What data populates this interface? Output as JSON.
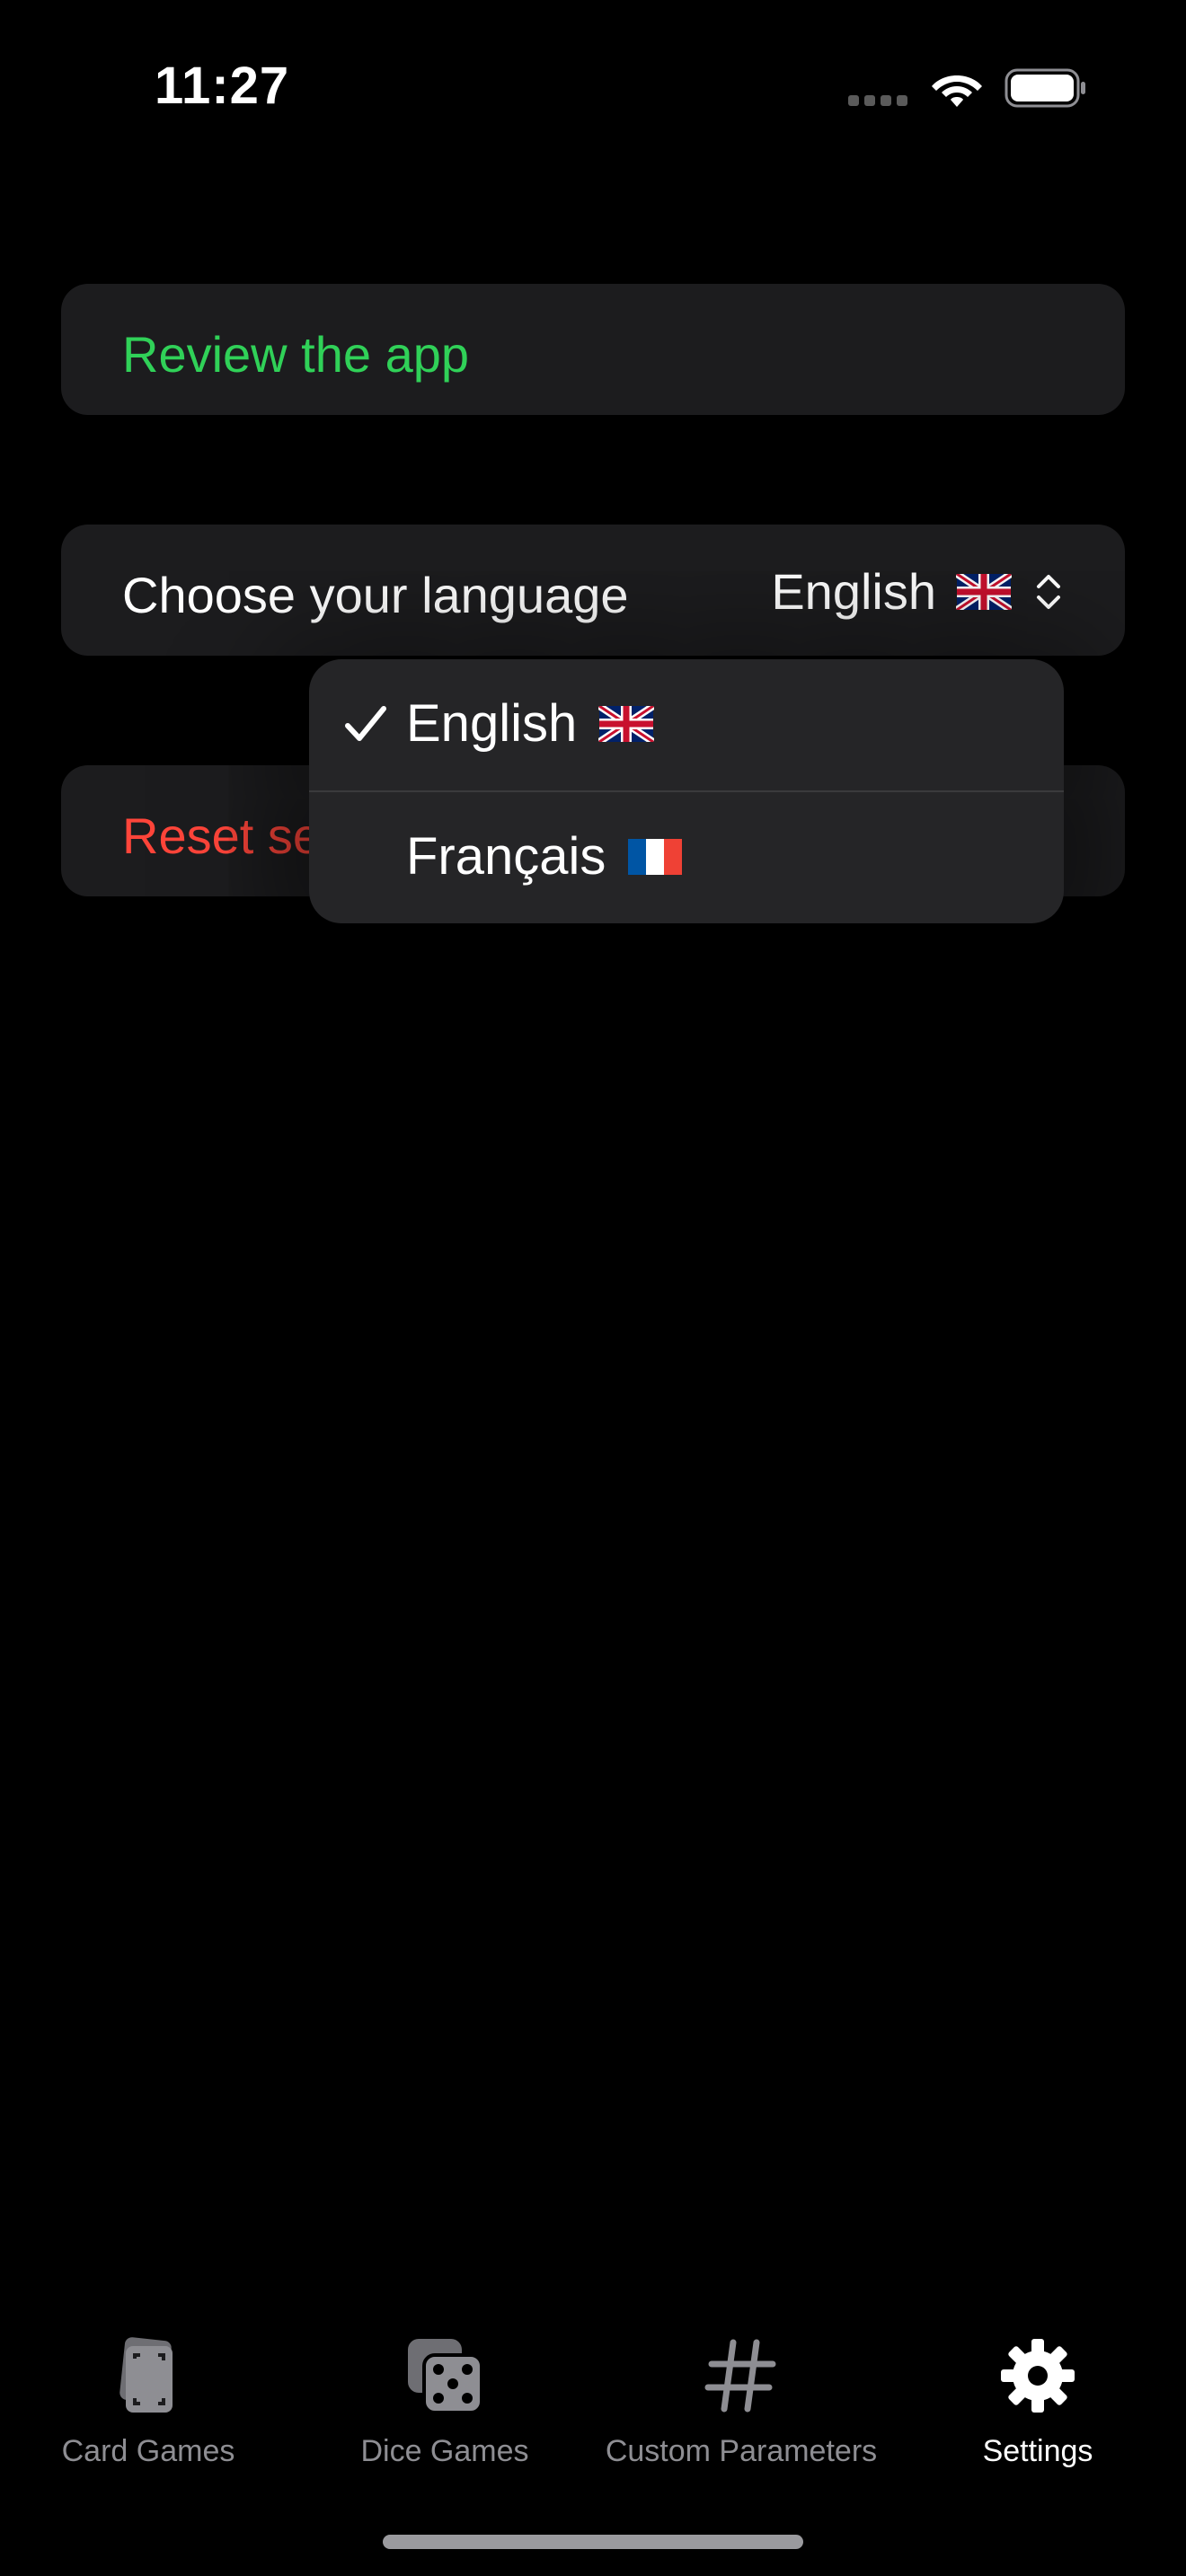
{
  "status_bar": {
    "time": "11:27"
  },
  "settings": {
    "review_label": "Review the app",
    "language_label": "Choose your language",
    "language_value": "English",
    "reset_label": "Reset settings"
  },
  "language_menu": {
    "options": [
      {
        "label": "English",
        "flag": "uk-flag-icon",
        "selected": true
      },
      {
        "label": "Français",
        "flag": "france-flag-icon",
        "selected": false
      }
    ]
  },
  "tab_bar": {
    "tabs": [
      {
        "label": "Card Games",
        "icon": "cards-icon"
      },
      {
        "label": "Dice Games",
        "icon": "dice-icon"
      },
      {
        "label": "Custom Parameters",
        "icon": "number-sign-icon"
      },
      {
        "label": "Settings",
        "icon": "gear-icon",
        "active": true
      }
    ]
  },
  "colors": {
    "accent_green": "#30d158",
    "destructive_red": "#ff453a",
    "row_bg": "#1c1c1e",
    "menu_bg": "#252527"
  }
}
